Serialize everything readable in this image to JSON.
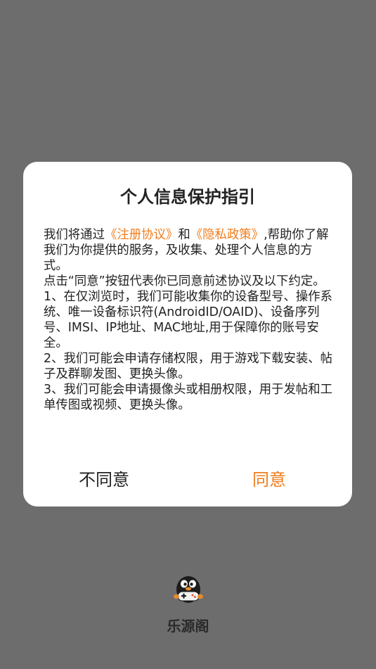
{
  "dialog": {
    "title": "个人信息保护指引",
    "intro_prefix": "我们将通过",
    "link_terms": "《注册协议》",
    "and_word": "和",
    "link_privacy": "《隐私政策》",
    "intro_suffix": ",帮助你了解我们为你提供的服务，及收集、处理个人信息的方式。",
    "consent_note": "点击“同意”按钮代表你已同意前述协议及以下约定。",
    "clause_1": "1、在仅浏览时，我们可能收集你的设备型号、操作系统、唯一设备标识符(AndroidID/OAID)、设备序列号、IMSI、IP地址、MAC地址,用于保障你的账号安全。",
    "clause_2": "2、我们可能会申请存储权限，用于游戏下载安装、帖子及群聊发图、更换头像。",
    "clause_3": "3、我们可能会申请摄像头或相册权限，用于发帖和工单传图或视频、更换头像。",
    "disagree_label": "不同意",
    "agree_label": "同意"
  },
  "app": {
    "name": "乐源阁",
    "logo_icon": "penguin-gamepad-icon"
  },
  "colors": {
    "overlay": "#6d6d6d",
    "accent": "#f07c1d",
    "text": "#222222"
  }
}
